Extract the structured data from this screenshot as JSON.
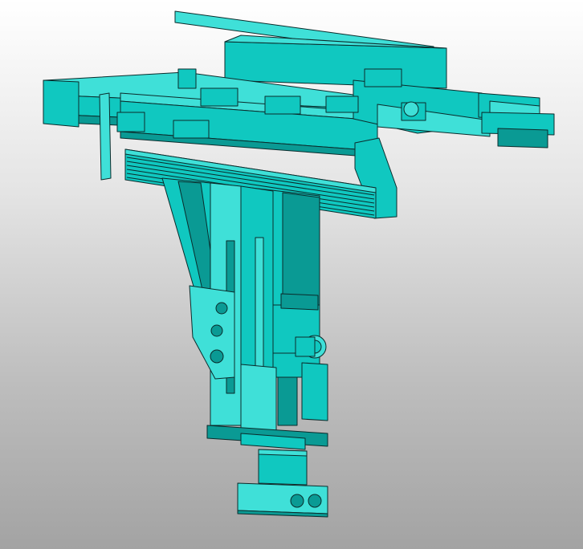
{
  "scene": {
    "subject": "cad-3d-model",
    "background": {
      "top": "#ffffff",
      "bottom": "#a3a3a3"
    },
    "model_fill": "#10c8c0",
    "model_fill_light": "#3fe0d8",
    "model_fill_dark": "#0a9a94",
    "edge_color": "#0b2b2b"
  }
}
